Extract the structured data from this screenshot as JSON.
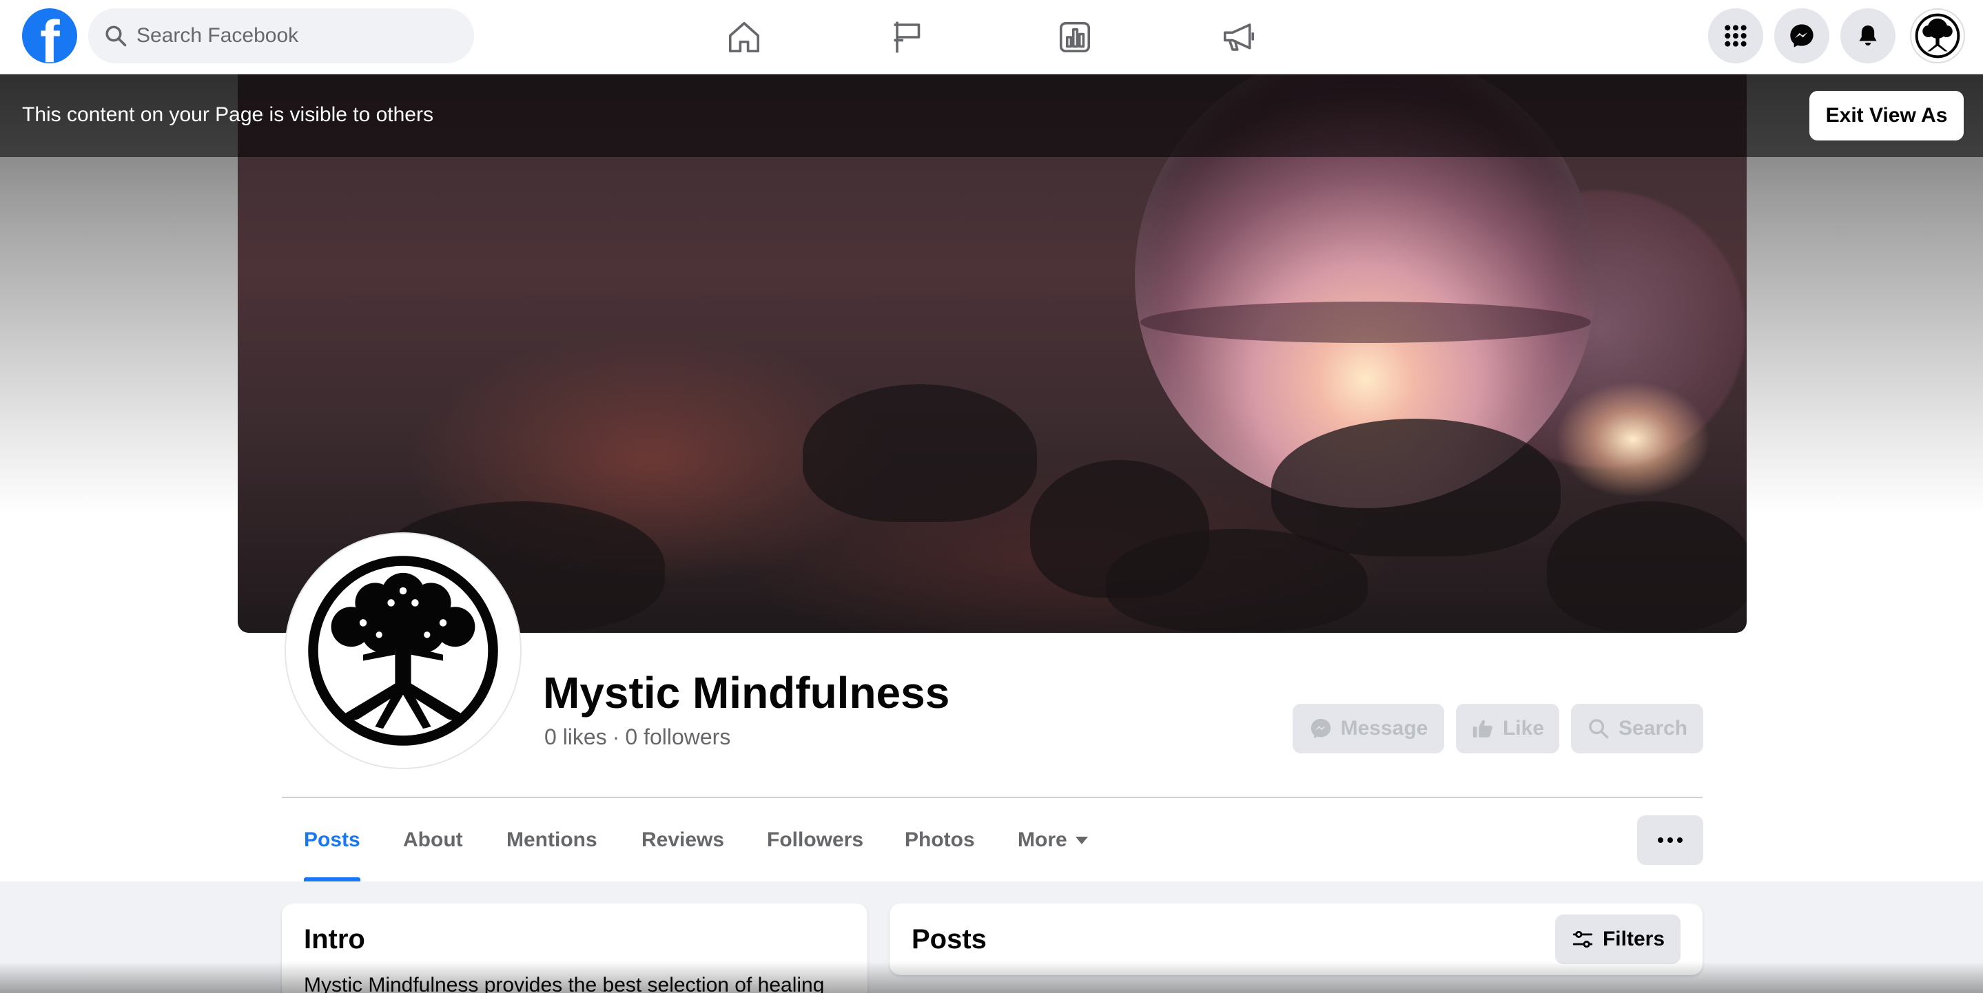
{
  "topbar": {
    "logo_letter": "f",
    "search_placeholder": "Search Facebook",
    "nav_icons": [
      "home-icon",
      "flag-icon",
      "insights-icon",
      "megaphone-icon"
    ],
    "right_icons": [
      "menu-grid-icon",
      "messenger-icon",
      "bell-icon"
    ]
  },
  "view_as": {
    "message": "This content on your Page is visible to others",
    "exit_label": "Exit View As"
  },
  "page": {
    "name": "Mystic Mindfulness",
    "likes": "0 likes",
    "separator": "·",
    "followers": "0 followers"
  },
  "actions": {
    "message_label": "Message",
    "like_label": "Like",
    "search_label": "Search"
  },
  "tabs": [
    {
      "label": "Posts",
      "active": true
    },
    {
      "label": "About"
    },
    {
      "label": "Mentions"
    },
    {
      "label": "Reviews"
    },
    {
      "label": "Followers"
    },
    {
      "label": "Photos"
    },
    {
      "label": "More"
    }
  ],
  "intro": {
    "title": "Intro",
    "text": "Mystic Mindfulness provides the best selection of healing"
  },
  "posts": {
    "title": "Posts",
    "filters_label": "Filters"
  },
  "colors": {
    "brand": "#1877f2",
    "button_bg": "#e4e6eb",
    "disabled_text": "#bcc0c4",
    "secondary_text": "#65676b"
  }
}
